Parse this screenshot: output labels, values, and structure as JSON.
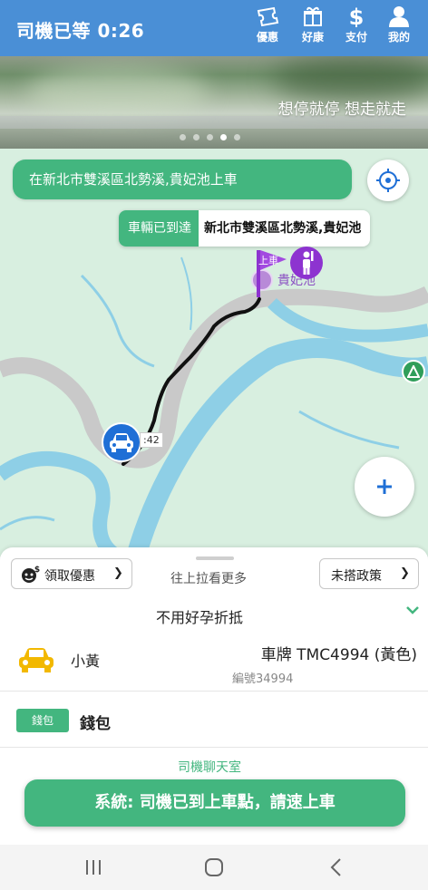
{
  "header": {
    "title": "司機已等 0:26",
    "buttons": [
      {
        "label": "優惠",
        "icon": "ticket-icon"
      },
      {
        "label": "好康",
        "icon": "gift-icon"
      },
      {
        "label": "支付",
        "icon": "dollar-icon"
      },
      {
        "label": "我的",
        "icon": "user-icon"
      }
    ]
  },
  "banner": {
    "slogan": "想停就停 想走就走",
    "slide_count": 5,
    "active_slide": 4
  },
  "map": {
    "pickup_pill": "在新北市雙溪區北勢溪,貴妃池上車",
    "arrived_tag": "車輛已到達",
    "arrived_address": "新北市雙溪區北勢溪,貴妃池",
    "poi_label": "貴妃池",
    "flag_label": "上車",
    "car_time_label": ":42"
  },
  "sheet": {
    "coupon_button": "領取優惠",
    "pull_hint": "往上拉看更多",
    "policy_button": "未搭政策",
    "discount_text": "不用好孕折抵",
    "car_type": "小黃",
    "plate": "車牌 TMC4994 (黃色)",
    "driver_id": "編號34994",
    "wallet_tag": "錢包",
    "wallet_label": "錢包",
    "chat_label": "司機聊天室",
    "action_button": "系統: 司機已到上車點，請速上車"
  },
  "colors": {
    "header_blue": "#4a8fd6",
    "accent_green": "#43b67f",
    "pin_purple": "#8d33d0",
    "car_blue": "#1f6fd6"
  }
}
